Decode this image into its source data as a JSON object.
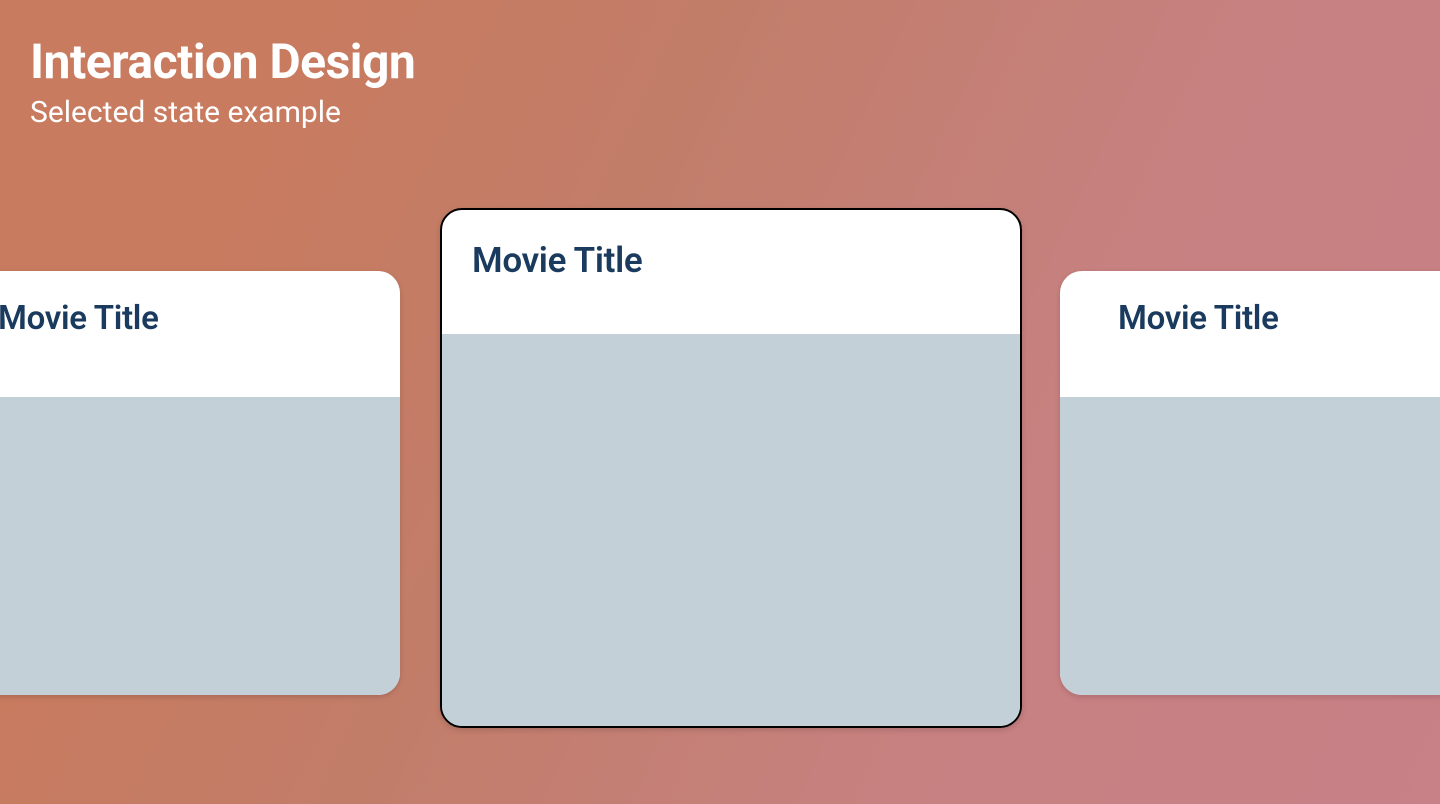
{
  "heading": {
    "title": "Interaction Design",
    "subtitle": "Selected state example"
  },
  "cards": [
    {
      "title": "Movie Title"
    },
    {
      "title": "Movie Title"
    },
    {
      "title": "Movie Title"
    }
  ]
}
